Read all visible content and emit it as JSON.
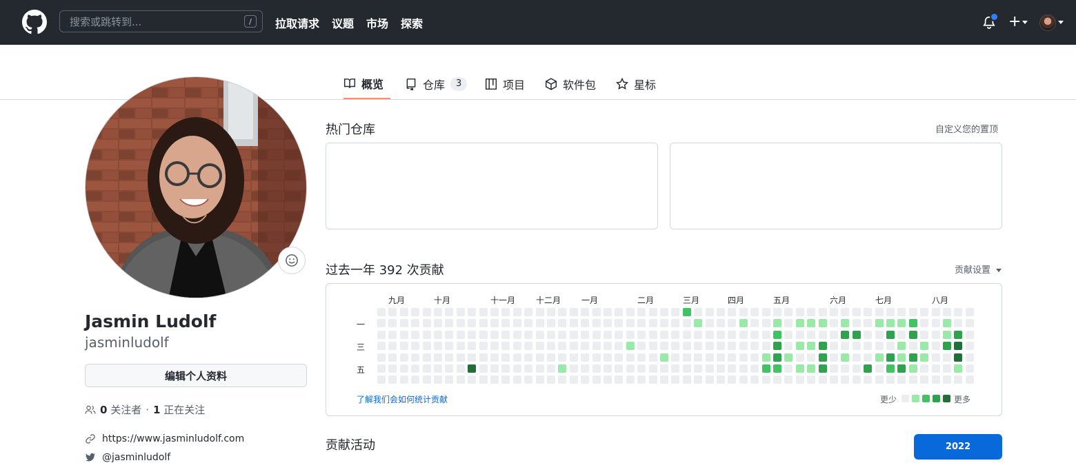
{
  "header": {
    "search_placeholder": "搜索或跳转到...",
    "search_shortcut": "/",
    "nav": [
      "拉取请求",
      "议题",
      "市场",
      "探索"
    ],
    "plus": "+"
  },
  "tabs": [
    {
      "label": "概览",
      "icon": "book-icon",
      "active": true
    },
    {
      "label": "仓库",
      "icon": "repo-icon",
      "count": "3"
    },
    {
      "label": "项目",
      "icon": "project-icon"
    },
    {
      "label": "软件包",
      "icon": "package-icon"
    },
    {
      "label": "星标",
      "icon": "star-icon"
    }
  ],
  "profile": {
    "name": "Jasmin Ludolf",
    "login": "jasminludolf",
    "edit_label": "编辑个人资料",
    "followers_count": "0",
    "followers_label": "关注者",
    "separator": "·",
    "following_count": "1",
    "following_label": "正在关注",
    "website": "https://www.jasminludolf.com",
    "twitter": "@jasminludolf"
  },
  "pinned": {
    "title": "热门仓库",
    "customize": "自定义您的置顶"
  },
  "contributions": {
    "title": "过去一年 392 次贡献",
    "settings": "贡献设置",
    "months": [
      "九月",
      "十月",
      "十一月",
      "十二月",
      "一月",
      "二月",
      "三月",
      "四月",
      "五月",
      "六月",
      "七月",
      "八月"
    ],
    "days": [
      "一",
      "三",
      "五"
    ],
    "learn": "了解我们会如何统计贡献",
    "less": "更少",
    "more": "更多",
    "colors": [
      "#ebedf0",
      "#9be9a8",
      "#40c463",
      "#30a14e",
      "#216e39"
    ],
    "weeks": [
      [
        0,
        0,
        0,
        0,
        0,
        0,
        0
      ],
      [
        0,
        0,
        0,
        0,
        0,
        0,
        0
      ],
      [
        0,
        0,
        0,
        0,
        0,
        0,
        0
      ],
      [
        0,
        0,
        0,
        0,
        0,
        0,
        0
      ],
      [
        0,
        0,
        0,
        0,
        0,
        0,
        0
      ],
      [
        0,
        0,
        0,
        0,
        0,
        0,
        0
      ],
      [
        0,
        0,
        0,
        0,
        0,
        0,
        0
      ],
      [
        0,
        0,
        0,
        0,
        0,
        0,
        0
      ],
      [
        0,
        0,
        0,
        0,
        0,
        4,
        0
      ],
      [
        0,
        0,
        0,
        0,
        0,
        0,
        0
      ],
      [
        0,
        0,
        0,
        0,
        0,
        0,
        0
      ],
      [
        0,
        0,
        0,
        0,
        0,
        0,
        0
      ],
      [
        0,
        0,
        0,
        0,
        0,
        0,
        0
      ],
      [
        0,
        0,
        0,
        0,
        0,
        0,
        0
      ],
      [
        0,
        0,
        0,
        0,
        0,
        0,
        0
      ],
      [
        0,
        0,
        0,
        0,
        0,
        0,
        0
      ],
      [
        0,
        0,
        0,
        0,
        0,
        1,
        0
      ],
      [
        0,
        0,
        0,
        0,
        0,
        0,
        0
      ],
      [
        0,
        0,
        0,
        0,
        0,
        0,
        0
      ],
      [
        0,
        0,
        0,
        0,
        0,
        0,
        0
      ],
      [
        0,
        0,
        0,
        0,
        0,
        0,
        0
      ],
      [
        0,
        0,
        0,
        0,
        0,
        0,
        0
      ],
      [
        0,
        0,
        0,
        1,
        0,
        0,
        0
      ],
      [
        0,
        0,
        0,
        0,
        0,
        0,
        0
      ],
      [
        0,
        0,
        0,
        0,
        0,
        0,
        0
      ],
      [
        0,
        0,
        0,
        0,
        1,
        0,
        0
      ],
      [
        0,
        0,
        0,
        0,
        0,
        0,
        0
      ],
      [
        2,
        0,
        0,
        0,
        0,
        0,
        0
      ],
      [
        0,
        1,
        0,
        0,
        0,
        0,
        0
      ],
      [
        0,
        0,
        0,
        0,
        0,
        0,
        0
      ],
      [
        0,
        0,
        0,
        0,
        0,
        0,
        0
      ],
      [
        0,
        0,
        0,
        0,
        0,
        0,
        0
      ],
      [
        0,
        1,
        0,
        0,
        0,
        0,
        0
      ],
      [
        0,
        0,
        0,
        0,
        0,
        0,
        0
      ],
      [
        0,
        0,
        0,
        0,
        1,
        2,
        0
      ],
      [
        0,
        1,
        2,
        3,
        3,
        2,
        0
      ],
      [
        0,
        0,
        0,
        0,
        1,
        0,
        0
      ],
      [
        0,
        1,
        0,
        1,
        0,
        1,
        0
      ],
      [
        0,
        1,
        0,
        1,
        0,
        1,
        0
      ],
      [
        0,
        1,
        0,
        3,
        3,
        3,
        0
      ],
      [
        0,
        0,
        0,
        0,
        0,
        0,
        0
      ],
      [
        0,
        1,
        3,
        0,
        1,
        0,
        0
      ],
      [
        0,
        0,
        3,
        0,
        0,
        0,
        0
      ],
      [
        0,
        0,
        0,
        0,
        0,
        3,
        0
      ],
      [
        0,
        1,
        0,
        0,
        1,
        0,
        0
      ],
      [
        0,
        1,
        3,
        0,
        3,
        2,
        0
      ],
      [
        0,
        1,
        0,
        1,
        1,
        3,
        0
      ],
      [
        0,
        2,
        3,
        0,
        3,
        1,
        0
      ],
      [
        0,
        0,
        0,
        1,
        1,
        0,
        0
      ],
      [
        0,
        0,
        0,
        0,
        0,
        0,
        0
      ],
      [
        0,
        1,
        1,
        3,
        0,
        0,
        0
      ],
      [
        0,
        0,
        3,
        4,
        4,
        1,
        0
      ],
      [
        0,
        0,
        0,
        0,
        0,
        0,
        0
      ]
    ]
  },
  "activity": {
    "title": "贡献活动",
    "year": "2022"
  }
}
